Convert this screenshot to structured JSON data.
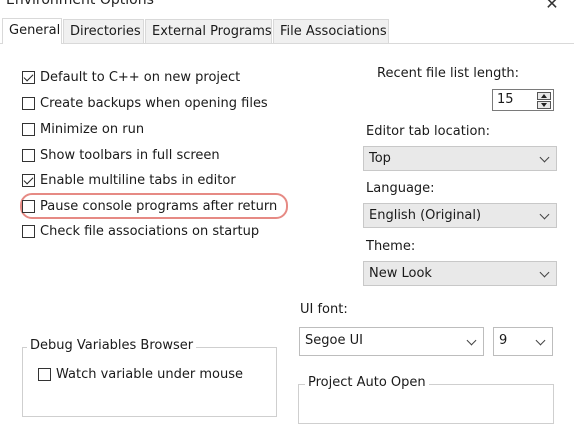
{
  "window": {
    "title": "Environment Options",
    "close_glyph": "✕"
  },
  "tabs": [
    {
      "label": "General",
      "active": true
    },
    {
      "label": "Directories",
      "active": false
    },
    {
      "label": "External Programs",
      "active": false
    },
    {
      "label": "File Associations",
      "active": false
    }
  ],
  "options": [
    {
      "label": "Default to C++ on new project",
      "checked": true
    },
    {
      "label": "Create backups when opening files",
      "checked": false
    },
    {
      "label": "Minimize on run",
      "checked": false
    },
    {
      "label": "Show toolbars in full screen",
      "checked": false
    },
    {
      "label": "Enable multiline tabs in editor",
      "checked": true
    },
    {
      "label": "Pause console programs after return",
      "checked": false,
      "highlighted": true
    },
    {
      "label": "Check file associations on startup",
      "checked": false
    }
  ],
  "recent_files": {
    "label": "Recent file list length:",
    "value": "15"
  },
  "editor_tab": {
    "label": "Editor tab location:",
    "value": "Top"
  },
  "language": {
    "label": "Language:",
    "value": "English (Original)"
  },
  "theme": {
    "label": "Theme:",
    "value": "New Look"
  },
  "ui_font": {
    "label": "UI font:",
    "value": "Segoe UI",
    "size": "9"
  },
  "debug_group": {
    "title": "Debug Variables Browser",
    "watch_label": "Watch variable under mouse",
    "watch_checked": false
  },
  "project_group": {
    "title": "Project Auto Open"
  },
  "colors": {
    "highlight_ring": "#e68a84",
    "tab_border": "#d9d9d9"
  },
  "icons": {
    "checkbox": "check-icon",
    "dropdown": "chevron-down-icon",
    "close": "close-icon"
  }
}
